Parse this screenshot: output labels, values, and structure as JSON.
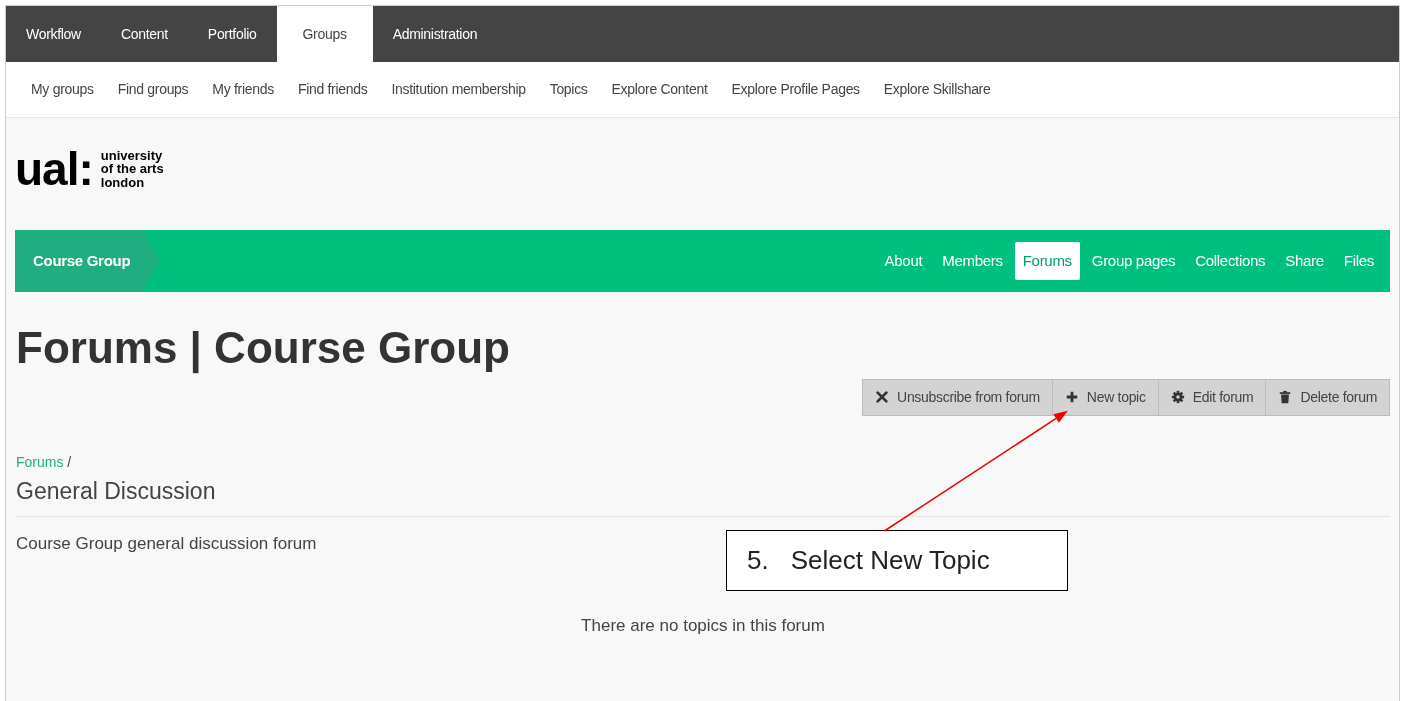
{
  "main_nav": [
    {
      "label": "Workflow",
      "selected": false
    },
    {
      "label": "Content",
      "selected": false
    },
    {
      "label": "Portfolio",
      "selected": false
    },
    {
      "label": "Groups",
      "selected": true
    },
    {
      "label": "Administration",
      "selected": false
    }
  ],
  "sub_nav": [
    "My groups",
    "Find groups",
    "My friends",
    "Find friends",
    "Institution membership",
    "Topics",
    "Explore Content",
    "Explore Profile Pages",
    "Explore Skillshare"
  ],
  "logo": {
    "mark": "ual:",
    "lines": [
      "university",
      "of the arts",
      "london"
    ]
  },
  "group_bar": {
    "title": "Course Group",
    "tabs": [
      {
        "label": "About",
        "selected": false
      },
      {
        "label": "Members",
        "selected": false
      },
      {
        "label": "Forums",
        "selected": true
      },
      {
        "label": "Group pages",
        "selected": false
      },
      {
        "label": "Collections",
        "selected": false
      },
      {
        "label": "Share",
        "selected": false
      },
      {
        "label": "Files",
        "selected": false
      }
    ]
  },
  "page_title": "Forums | Course Group",
  "actions": [
    {
      "kind": "unsubscribe",
      "label": "Unsubscribe from forum"
    },
    {
      "kind": "add",
      "label": "New topic"
    },
    {
      "kind": "edit",
      "label": "Edit forum"
    },
    {
      "kind": "delete",
      "label": "Delete forum"
    }
  ],
  "breadcrumb": {
    "link": "Forums",
    "separator": "/"
  },
  "forum_title": "General Discussion",
  "description": "Course Group general discussion forum",
  "empty_message": "There are no topics in this forum",
  "annotation": {
    "number": "5.",
    "text": "Select New Topic"
  }
}
